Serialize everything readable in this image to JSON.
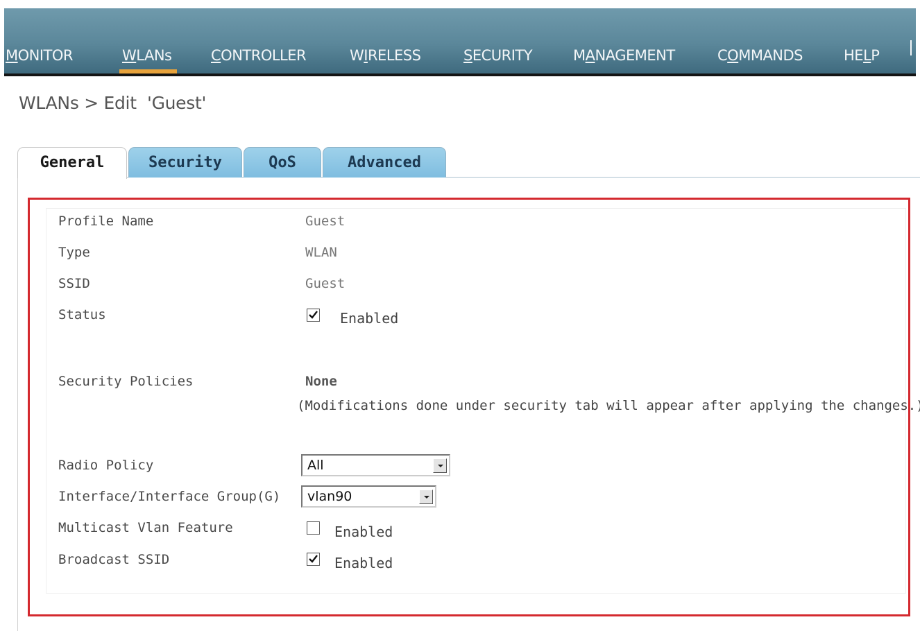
{
  "nav": {
    "items": [
      {
        "pre": "",
        "key": "M",
        "post": "ONITOR"
      },
      {
        "pre": "",
        "key": "W",
        "post": "LANs"
      },
      {
        "pre": "",
        "key": "C",
        "post": "ONTROLLER"
      },
      {
        "pre": "W",
        "key": "I",
        "post": "RELESS"
      },
      {
        "pre": "",
        "key": "S",
        "post": "ECURITY"
      },
      {
        "pre": "M",
        "key": "A",
        "post": "NAGEMENT"
      },
      {
        "pre": "C",
        "key": "O",
        "post": "MMANDS"
      },
      {
        "pre": "HE",
        "key": "L",
        "post": "P"
      }
    ],
    "active": "WLANs"
  },
  "page": {
    "title": "WLANs > Edit  'Guest'"
  },
  "tabs": [
    {
      "label": "General"
    },
    {
      "label": "Security"
    },
    {
      "label": "QoS"
    },
    {
      "label": "Advanced"
    }
  ],
  "general": {
    "profile_name_label": "Profile Name",
    "profile_name_value": "Guest",
    "type_label": "Type",
    "type_value": "WLAN",
    "ssid_label": "SSID",
    "ssid_value": "Guest",
    "status_label": "Status",
    "status_checked": true,
    "status_text": "Enabled",
    "security_policies_label": "Security Policies",
    "security_policies_value": "None",
    "security_policies_note": "(Modifications done under security tab will appear after applying the changes.)",
    "radio_policy_label": "Radio Policy",
    "radio_policy_value": "All",
    "interface_label": "Interface/Interface Group(G)",
    "interface_value": "vlan90",
    "multicast_label": "Multicast Vlan Feature",
    "multicast_checked": false,
    "multicast_text": "Enabled",
    "broadcast_label": "Broadcast SSID",
    "broadcast_checked": true,
    "broadcast_text": "Enabled"
  },
  "colors": {
    "nav_bg": "#5b879a",
    "nav_active_underline": "#e8a33c",
    "tab_bg": "#8ec7e6",
    "highlight_border": "#d4292f"
  }
}
